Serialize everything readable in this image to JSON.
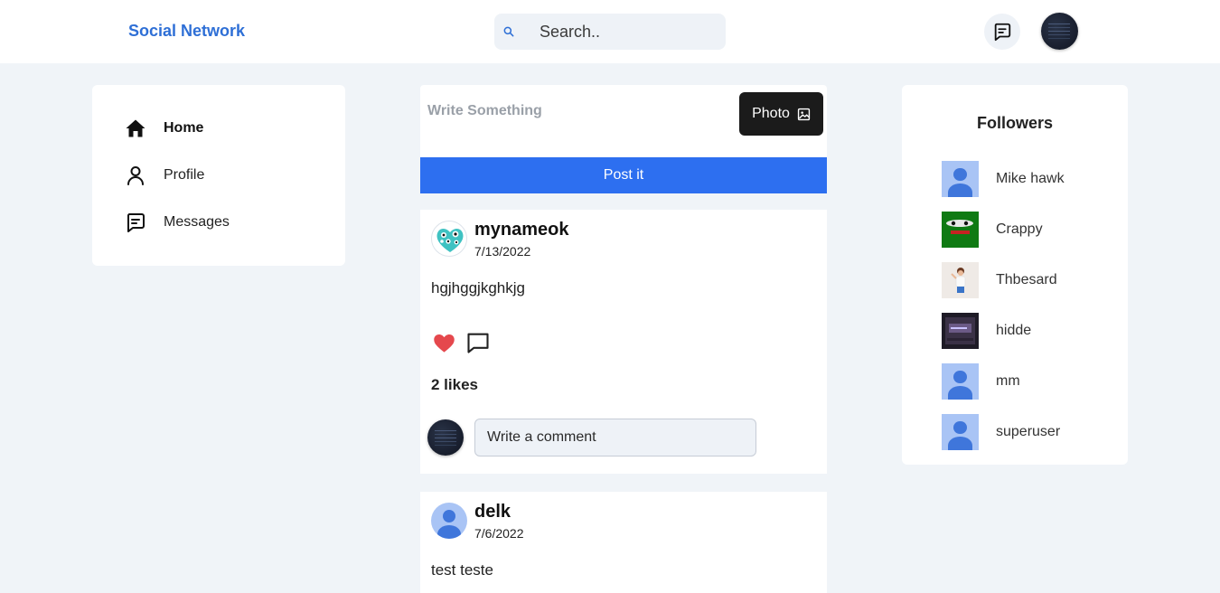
{
  "header": {
    "brand": "Social Network",
    "search_placeholder": "Search.."
  },
  "nav": {
    "items": [
      {
        "label": "Home",
        "icon": "home-icon",
        "active": true
      },
      {
        "label": "Profile",
        "icon": "user-icon",
        "active": false
      },
      {
        "label": "Messages",
        "icon": "message-icon",
        "active": false
      }
    ]
  },
  "composer": {
    "placeholder": "Write Something",
    "photo_label": "Photo",
    "post_label": "Post it"
  },
  "posts": [
    {
      "author": "mynameok",
      "date": "7/13/2022",
      "text": "hgjhggjkghkjg",
      "likes_text": "2 likes",
      "comment_placeholder": "Write a comment"
    },
    {
      "author": "delk",
      "date": "7/6/2022",
      "text": "test teste"
    }
  ],
  "followers": {
    "title": "Followers",
    "items": [
      {
        "name": "Mike hawk"
      },
      {
        "name": "Crappy"
      },
      {
        "name": "Thbesard"
      },
      {
        "name": "hidde"
      },
      {
        "name": "mm"
      },
      {
        "name": "superuser"
      }
    ]
  },
  "colors": {
    "brand": "#2e6fd6",
    "primary_button": "#2d6ff0",
    "dark_button": "#1b1b1b",
    "background": "#f0f4f8",
    "like": "#e5484d"
  }
}
